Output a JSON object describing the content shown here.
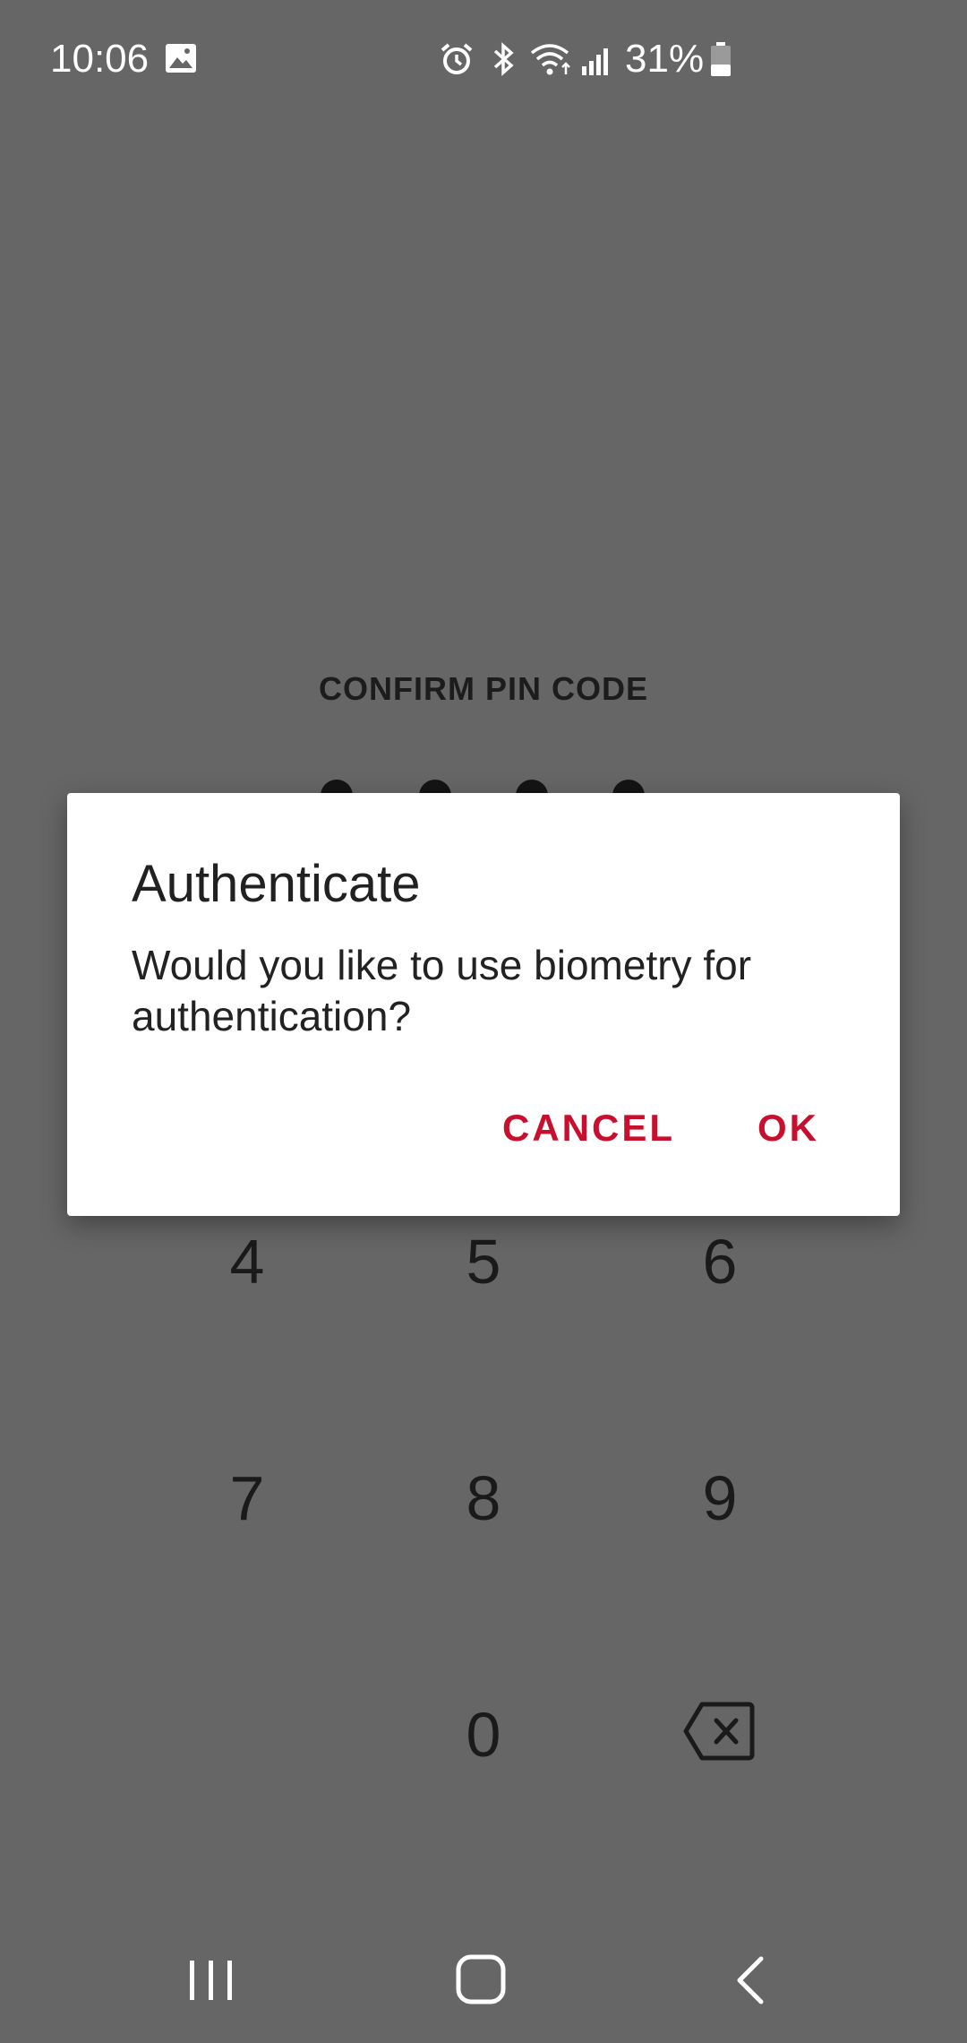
{
  "status_bar": {
    "time": "10:06",
    "battery_percent": "31%",
    "icons": [
      "image-icon",
      "alarm-icon",
      "bluetooth-icon",
      "wifi-icon",
      "signal-icon",
      "battery-icon"
    ]
  },
  "pin_screen": {
    "title": "CONFIRM PIN CODE",
    "digits_entered": 4,
    "keypad": {
      "key_4": "4",
      "key_5": "5",
      "key_6": "6",
      "key_7": "7",
      "key_8": "8",
      "key_9": "9",
      "key_0": "0"
    }
  },
  "dialog": {
    "title": "Authenticate",
    "message": "Would you like to use biometry for authentication?",
    "cancel_label": "CANCEL",
    "ok_label": "OK",
    "accent_color": "#c8102e"
  },
  "nav_bar": {
    "icons": [
      "recent-apps-icon",
      "home-icon",
      "back-icon"
    ]
  },
  "colors": {
    "scrim_background": "#666666",
    "dialog_background": "#ffffff"
  }
}
